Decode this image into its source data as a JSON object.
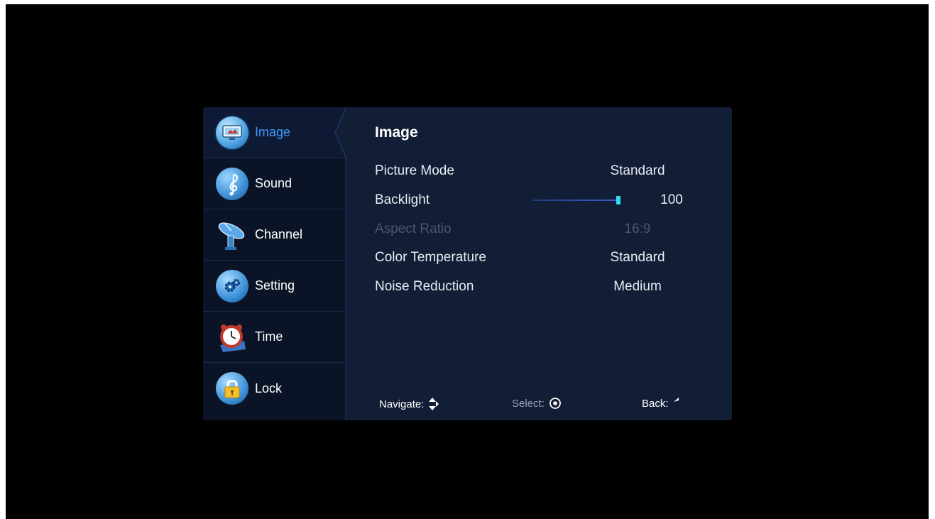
{
  "sidebar": {
    "items": [
      {
        "label": "Image",
        "icon": "image-monitor-icon",
        "active": true
      },
      {
        "label": "Sound",
        "icon": "music-note-icon"
      },
      {
        "label": "Channel",
        "icon": "satellite-dish-icon"
      },
      {
        "label": "Setting",
        "icon": "gears-icon"
      },
      {
        "label": "Time",
        "icon": "alarm-clock-icon"
      },
      {
        "label": "Lock",
        "icon": "padlock-icon"
      }
    ]
  },
  "main": {
    "title": "Image",
    "rows": [
      {
        "label": "Picture Mode",
        "value": "Standard"
      },
      {
        "label": "Backlight",
        "value": "100",
        "slider_fraction": 1.0
      },
      {
        "label": "Aspect Ratio",
        "value": "16:9",
        "disabled": true
      },
      {
        "label": "Color Temperature",
        "value": "Standard"
      },
      {
        "label": "Noise Reduction",
        "value": "Medium"
      }
    ]
  },
  "footer": {
    "navigate_label": "Navigate:",
    "select_label": "Select:",
    "back_label": "Back:"
  },
  "colors": {
    "accent": "#3d9bff",
    "panel": "#121d36",
    "sidebar": "#0b1426",
    "slider_knob": "#34e0f0"
  }
}
